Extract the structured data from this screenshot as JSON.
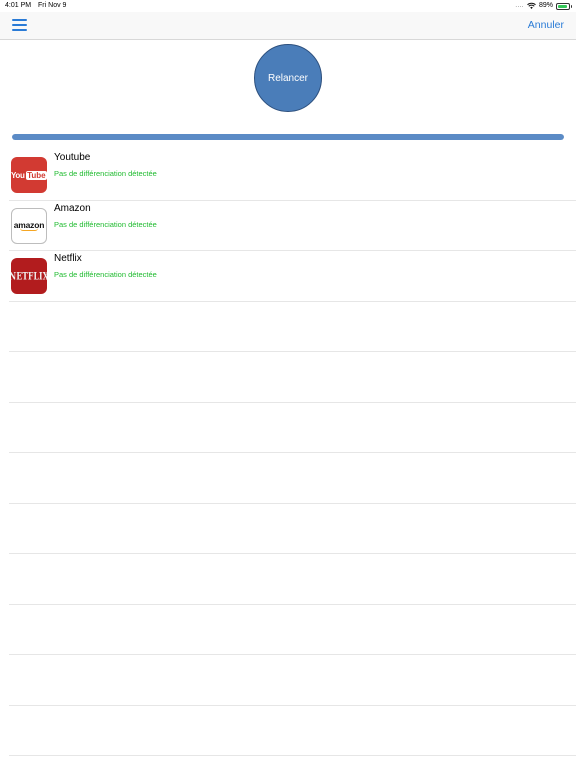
{
  "status_bar": {
    "time": "4:01 PM",
    "date": "Fri Nov 9",
    "signal": "....",
    "battery_percent": "89%",
    "battery_level": 0.89
  },
  "nav": {
    "cancel_label": "Annuler",
    "menu_icon": "hamburger-menu-icon"
  },
  "relaunch": {
    "label": "Relancer"
  },
  "progress": {
    "value": 1.0,
    "color": "#5b8bc6"
  },
  "apps": [
    {
      "name": "Youtube",
      "status": "Pas de différenciation détectée",
      "logo_you": "You",
      "logo_tube": "Tube"
    },
    {
      "name": "Amazon",
      "status": "Pas de différenciation détectée",
      "logo_word": "amazon"
    },
    {
      "name": "Netflix",
      "status": "Pas de différenciation détectée",
      "logo_word": "NETFLIX"
    }
  ],
  "colors": {
    "accent": "#2a7bd6",
    "status_ok": "#1fbb2f",
    "button_fill": "#4a7db9"
  }
}
